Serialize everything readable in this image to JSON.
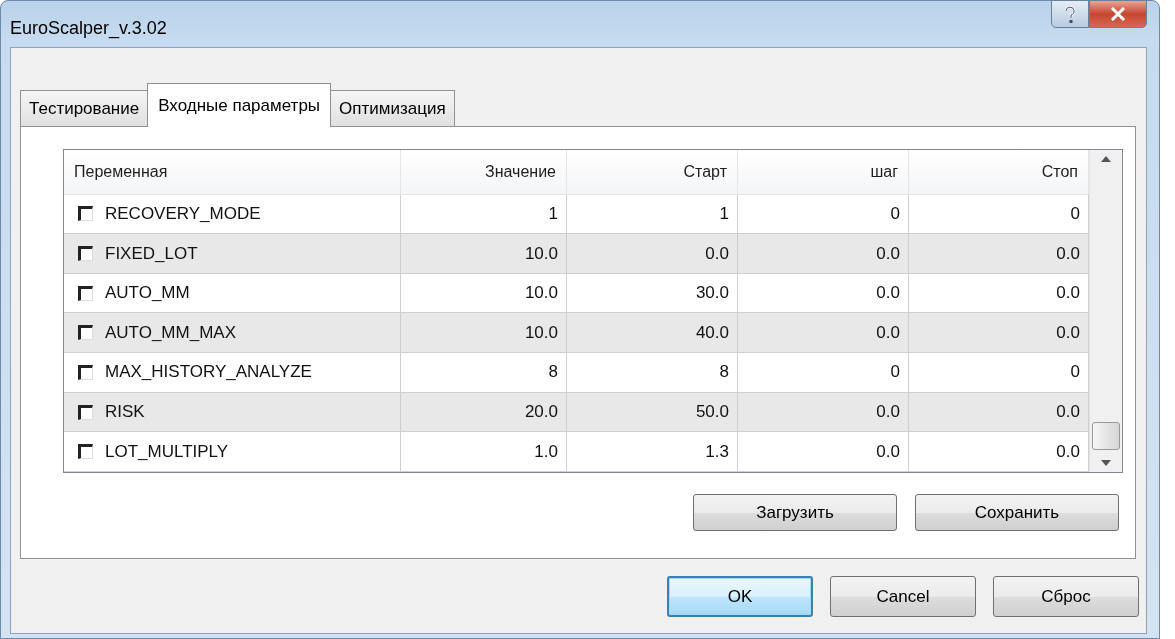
{
  "window": {
    "title": "EuroScalper_v.3.02"
  },
  "tabs": [
    {
      "label": "Тестирование",
      "selected": false
    },
    {
      "label": "Входные параметры",
      "selected": true
    },
    {
      "label": "Оптимизация",
      "selected": false
    }
  ],
  "table": {
    "columns": [
      "Переменная",
      "Значение",
      "Старт",
      "шаг",
      "Стоп"
    ],
    "rows": [
      {
        "checked": false,
        "name": "RECOVERY_MODE",
        "value": "1",
        "start": "1",
        "step": "0",
        "stop": "0"
      },
      {
        "checked": false,
        "name": "FIXED_LOT",
        "value": "10.0",
        "start": "0.0",
        "step": "0.0",
        "stop": "0.0"
      },
      {
        "checked": false,
        "name": "AUTO_MM",
        "value": "10.0",
        "start": "30.0",
        "step": "0.0",
        "stop": "0.0"
      },
      {
        "checked": false,
        "name": "AUTO_MM_MAX",
        "value": "10.0",
        "start": "40.0",
        "step": "0.0",
        "stop": "0.0"
      },
      {
        "checked": false,
        "name": "MAX_HISTORY_ANALYZE",
        "value": "8",
        "start": "8",
        "step": "0",
        "stop": "0"
      },
      {
        "checked": false,
        "name": "RISK",
        "value": "20.0",
        "start": "50.0",
        "step": "0.0",
        "stop": "0.0"
      },
      {
        "checked": false,
        "name": "LOT_MULTIPLY",
        "value": "1.0",
        "start": "1.3",
        "step": "0.0",
        "stop": "0.0"
      }
    ]
  },
  "panel_buttons": [
    "Загрузить",
    "Сохранить"
  ],
  "dialog_buttons": [
    {
      "label": "OK",
      "default": true
    },
    {
      "label": "Cancel",
      "default": false
    },
    {
      "label": "Сброс",
      "default": false
    }
  ]
}
